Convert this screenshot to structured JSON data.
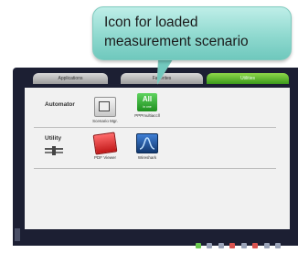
{
  "callout": {
    "line1": "Icon for loaded",
    "line2": "measurement scenario",
    "color": "#8fd9cf"
  },
  "tabs": [
    {
      "label": "Applications",
      "active": false
    },
    {
      "label": "Favorites",
      "active": false
    },
    {
      "label": "Utilities",
      "active": true
    }
  ],
  "sections": {
    "automator": {
      "title": "Automator",
      "apps": [
        {
          "label": "Scenario Mgr.",
          "icon": "scenario-icon"
        },
        {
          "label": "PPPmultiaccll",
          "icon": "ppp-multiaccess-icon",
          "badge_main": "All",
          "badge_sub": "in one"
        }
      ]
    },
    "utility": {
      "title": "Utility",
      "apps": [
        {
          "label": "PDF Viewer",
          "icon": "pdf-viewer-icon"
        },
        {
          "label": "Wireshark",
          "icon": "wireshark-icon"
        }
      ]
    }
  },
  "colors": {
    "screen_bg": "#1c1f33",
    "active_tab": "#3c9a1c"
  }
}
